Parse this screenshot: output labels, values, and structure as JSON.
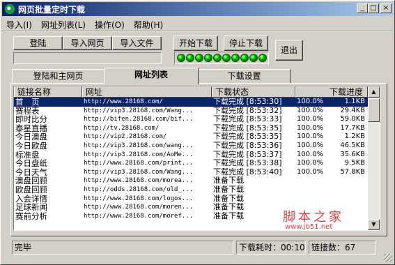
{
  "window": {
    "title": "网页批量定时下载"
  },
  "title_buttons": {
    "minimize": "_",
    "maximize": "□",
    "close": "×"
  },
  "menu": [
    "导入(I)",
    "网址列表(L)",
    "操作(O)",
    "帮助(H)"
  ],
  "toolbar": {
    "login": "登陆",
    "import_page": "导入网页",
    "import_file": "导入文件",
    "start_download": "开始下载",
    "stop_download": "停止下载",
    "exit": "退出"
  },
  "led_count": 10,
  "tabs": [
    {
      "label": "登陆和主网页",
      "active": false
    },
    {
      "label": "网址列表",
      "active": true
    },
    {
      "label": "下载设置",
      "active": false
    }
  ],
  "list": {
    "columns": [
      "链接名称",
      "网址",
      "下载状态",
      "下载进度"
    ],
    "rows": [
      {
        "name": "首　页",
        "url": "http://www.28168.com/",
        "status": "下载完成",
        "time": "[8:53:30]",
        "percent": "100.0%",
        "size": "1.1KB",
        "selected": true
      },
      {
        "name": "赛程表",
        "url": "http://vip3.28168.com/Wang...",
        "status": "下载完成",
        "time": "[8:53:32]",
        "percent": "100.0%",
        "size": "29.4KB"
      },
      {
        "name": "即时比分",
        "url": "http://bifen.28168.com/bif...",
        "status": "下载完成",
        "time": "[8:53:33]",
        "percent": "100.0%",
        "size": "59.0KB"
      },
      {
        "name": "泰星直播",
        "url": "http://tv.28168.com/",
        "status": "下载完成",
        "time": "[8:53:35]",
        "percent": "100.0%",
        "size": "17.7KB"
      },
      {
        "name": "今日澳盘",
        "url": "http://vip2.28168.com/",
        "status": "下载完成",
        "time": "[8:53:35]",
        "percent": "100.0%",
        "size": "1.2KB"
      },
      {
        "name": "今日欧盘",
        "url": "http://vip3.28168.com/wang...",
        "status": "下载完成",
        "time": "[8:53:36]",
        "percent": "100.0%",
        "size": "46.5KB"
      },
      {
        "name": "标准盘",
        "url": "http://vip3.28168.com/AoMe...",
        "status": "下载完成",
        "time": "[8:53:37]",
        "percent": "100.0%",
        "size": "35.6KB"
      },
      {
        "name": "今日盘纸",
        "url": "http://www.28168.com/print...",
        "status": "下载完成",
        "time": "[8:53:38]",
        "percent": "100.0%",
        "size": "9.5KB"
      },
      {
        "name": "今日天气",
        "url": "http://vip3.28168.com/Wang...",
        "status": "下载完成",
        "time": "[8:53:40]",
        "percent": "100.0%",
        "size": "57.8KB"
      },
      {
        "name": "澳盘回顾",
        "url": "http://www.28168.com/morea...",
        "status": "准备下载",
        "time": "",
        "percent": "",
        "size": ""
      },
      {
        "name": "欧盘回顾",
        "url": "http://odds.28168.com/old_...",
        "status": "准备下载",
        "time": "",
        "percent": "",
        "size": ""
      },
      {
        "name": "入会详情",
        "url": "http://www.28168.com/logos...",
        "status": "准备下载",
        "time": "",
        "percent": "",
        "size": ""
      },
      {
        "name": "足球新闻",
        "url": "http://www.28168.com/moren...",
        "status": "准备下载",
        "time": "",
        "percent": "",
        "size": ""
      },
      {
        "name": "赛前分析",
        "url": "http://www.28168.com/moref...",
        "status": "准备下载",
        "time": "",
        "percent": "",
        "size": ""
      }
    ]
  },
  "watermark": {
    "text": "脚本之家",
    "url": "www.jb51.net"
  },
  "status": {
    "message": "完毕",
    "elapsed": "下载耗时：00:10",
    "link_count": "链接数：67"
  }
}
